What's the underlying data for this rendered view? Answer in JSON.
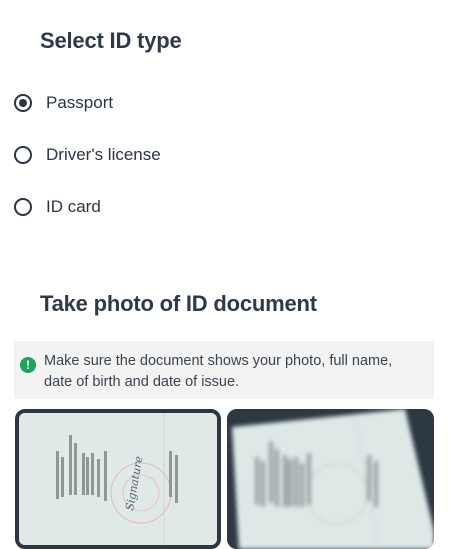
{
  "id_type": {
    "title": "Select ID type",
    "options": [
      {
        "label": "Passport",
        "selected": true
      },
      {
        "label": "Driver's license",
        "selected": false
      },
      {
        "label": "ID card",
        "selected": false
      }
    ]
  },
  "photo_section": {
    "title": "Take photo of ID document",
    "notice": "Make sure the document shows your photo, full name, date of birth and date of issue.",
    "notice_icon": "exclamation-icon",
    "examples": [
      {
        "name": "good-example",
        "signature_text": "Signature"
      },
      {
        "name": "bad-example-blurry"
      }
    ]
  },
  "colors": {
    "text": "#2b3542",
    "notice_bg": "#f2f3f2",
    "notice_icon": "#1ea35a",
    "card_dark": "#2e3843"
  }
}
